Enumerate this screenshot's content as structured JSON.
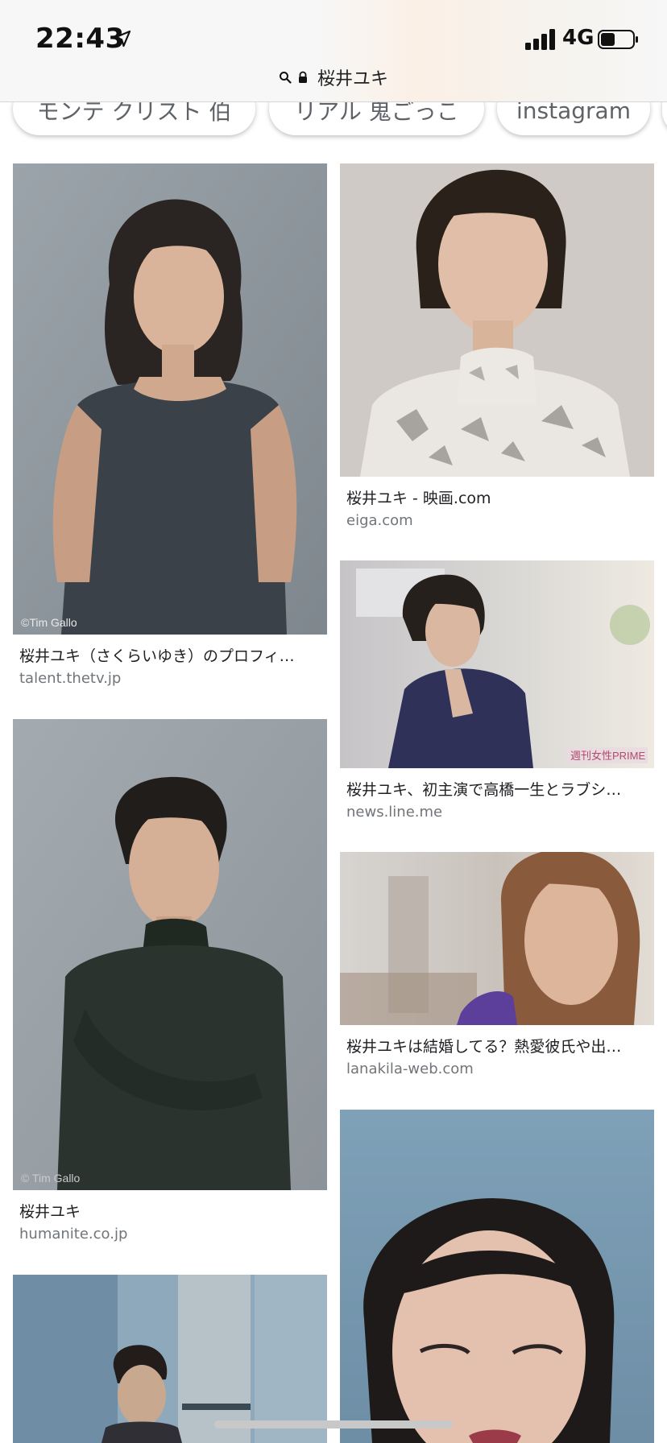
{
  "status_bar": {
    "time": "22:43",
    "network": "4G",
    "location_icon": "location-arrow-icon",
    "signal_icon": "signal-bars-icon",
    "battery_icon": "battery-icon"
  },
  "url_bar": {
    "query": "桜井ユキ",
    "search_icon": "search-icon",
    "lock_icon": "lock-icon"
  },
  "chips": [
    {
      "label": "モンテ クリスト 伯"
    },
    {
      "label": "リアル 鬼ごっこ"
    },
    {
      "label": "instagram"
    }
  ],
  "results": {
    "left": [
      {
        "title": "桜井ユキ（さくらいゆき）のプロフィ…",
        "source": "talent.thetv.jp",
        "watermark": "©Tim Gallo"
      },
      {
        "title": "桜井ユキ",
        "source": "humanite.co.jp",
        "watermark": "© Tim Gallo"
      },
      {
        "title": "",
        "source": ""
      }
    ],
    "right": [
      {
        "title": "桜井ユキ - 映画.com",
        "source": "eiga.com"
      },
      {
        "title": "桜井ユキ、初主演で高橋一生とラブシ…",
        "source": "news.line.me",
        "watermark": "週刊女性PRIME"
      },
      {
        "title": "桜井ユキは結婚してる？熱愛彼氏や出…",
        "source": "lanakila-web.com"
      },
      {
        "title": "",
        "source": ""
      }
    ]
  },
  "colors": {
    "title_text": "#202124",
    "source_text": "#70757a",
    "chip_text": "#5f6368"
  }
}
